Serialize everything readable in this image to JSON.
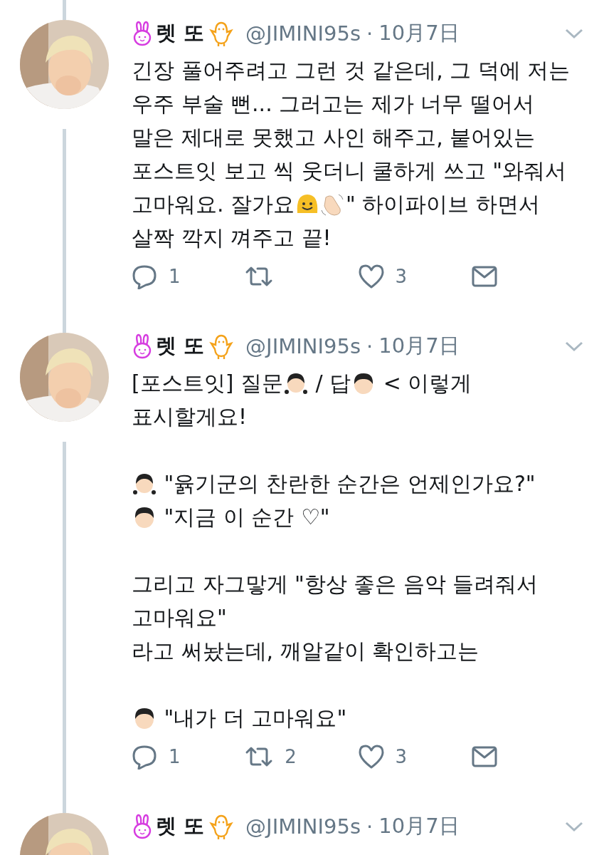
{
  "tweets": [
    {
      "author": {
        "name": "렛 또",
        "handle": "@JIMINI95s",
        "separator": "·",
        "date": "10月7日"
      },
      "avatar": {
        "kind": "picture"
      },
      "paragraphs": [
        [
          [
            {
              "text": "긴장 풀어주려고 그런 것 같은데, 그 덕에 저는"
            }
          ],
          [
            {
              "text": "우주 부술 뻔... 그러고는 제가 너무 떨어서"
            }
          ],
          [
            {
              "text": "말은 제대로 못했고 사인 해주고, 붙어있는"
            }
          ],
          [
            {
              "text": "포스트잇 보고 씩 웃더니 쿨하게 쓰고 \"와줘서"
            }
          ],
          [
            {
              "text": "고마워요. 잘가요"
            },
            {
              "kind": "smile"
            },
            {
              "kind": "wave"
            },
            {
              "text": "\" 하이파이브 하면서"
            }
          ],
          [
            {
              "text": "살짝 깍지 껴주고 끝!"
            }
          ]
        ]
      ],
      "actions": {
        "replies": "1",
        "likes": "3"
      }
    },
    {
      "author": {
        "name": "렛 또",
        "handle": "@JIMINI95s",
        "separator": "·",
        "date": "10月7日"
      },
      "avatar": {
        "kind": "picture"
      },
      "paragraphs": [
        [
          [
            {
              "text": "[포스트잇] 질문"
            },
            {
              "kind": "girl"
            },
            {
              "text": " / 답"
            },
            {
              "kind": "boy"
            },
            {
              "text": " < 이렇게"
            }
          ],
          [
            {
              "text": "표시할게요!"
            }
          ]
        ],
        [
          [
            {
              "kind": "girl"
            },
            {
              "text": " \"윩기군의 찬란한 순간은 언제인가요?\""
            }
          ],
          [
            {
              "kind": "boy"
            },
            {
              "text": " \"지금 이 순간 ♡\""
            }
          ]
        ],
        [
          [
            {
              "text": "그리고 자그맣게 \"항상 좋은 음악 들려줘서"
            }
          ],
          [
            {
              "text": "고마워요\""
            }
          ],
          [
            {
              "text": "라고 써놨는데, 깨알같이 확인하고는"
            }
          ]
        ],
        [
          [
            {
              "kind": "boy"
            },
            {
              "text": " \"내가 더 고마워요\""
            }
          ]
        ]
      ],
      "actions": {
        "replies": "1",
        "retweets": "2",
        "likes": "3"
      }
    },
    {
      "author": {
        "name": "렛 또",
        "handle": "@JIMINI95s",
        "separator": "·",
        "date": "10月7日"
      },
      "avatar": {
        "kind": "picture"
      }
    }
  ]
}
